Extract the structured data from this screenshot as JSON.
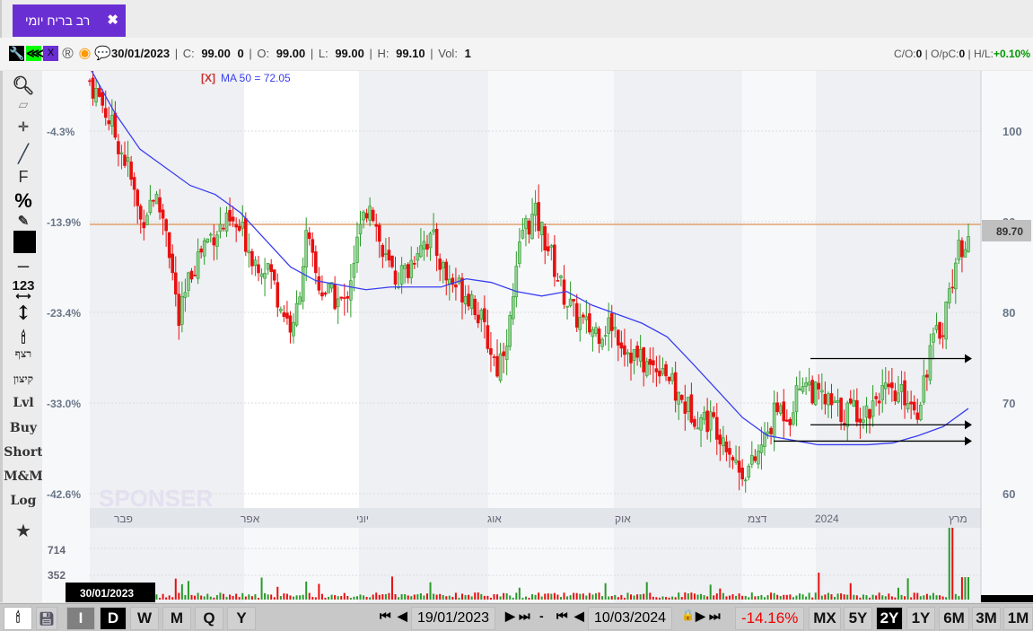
{
  "tab": {
    "title": "רב בריח יומי",
    "close": "✖"
  },
  "info": {
    "date": "30/01/2023",
    "c_label": "C:",
    "c": "99.00",
    "c_change": "0",
    "o_label": "O:",
    "o": "99.00",
    "l_label": "L:",
    "l": "99.00",
    "h_label": "H:",
    "h": "99.10",
    "vol_label": "Vol:",
    "vol": "1",
    "co_label": "C/O:",
    "co": "0",
    "opc_label": "O/pC:",
    "opc": "0",
    "hl_label": "H/L:",
    "hl": "+0.10%",
    "icons": [
      "wrench-icon",
      "share-icon",
      "excel-icon",
      "registered-icon",
      "target-icon",
      "comment-icon"
    ]
  },
  "toolbar": {
    "items": [
      "search",
      "eraser",
      "crosshair",
      "line",
      "F",
      "%",
      "edit",
      "color",
      "line-style",
      "123",
      "vertical",
      "candles",
      "רצף",
      "קיצון",
      "Lvl",
      "Buy",
      "Short",
      "M&M",
      "Log",
      "star"
    ]
  },
  "chart_data": {
    "type": "candlestick",
    "indicator": {
      "remove": "[X]",
      "label": "MA 50 = 72.05"
    },
    "price_axis": {
      "ticks": [
        60,
        70,
        80,
        90,
        100
      ],
      "ylim": [
        58,
        107
      ]
    },
    "percent_axis": [
      "-4.3%",
      "-13.9%",
      "-23.4%",
      "-33.0%",
      "-42.6%"
    ],
    "last_price": "89.70",
    "hline": 89.7,
    "months": [
      "פבר",
      "אפר",
      "יוני",
      "אוג",
      "אוק",
      "דצמ",
      "2024",
      "מרץ"
    ],
    "volume_ticks": [
      "714",
      "352"
    ],
    "closes": [
      105.5,
      103,
      99.6,
      96,
      90,
      93,
      89.7,
      78.8,
      84.7,
      87.7,
      89.2,
      89.7,
      88.7,
      85.7,
      85.2,
      80.8,
      77.8,
      88.2,
      82.8,
      81.8,
      80.8,
      87.7,
      92.7,
      86.2,
      83.8,
      84.7,
      88.2,
      87.7,
      83.8,
      82.8,
      81.8,
      77.8,
      73.9,
      78.8,
      89.2,
      90.6,
      87.2,
      82.8,
      79.8,
      78.3,
      78,
      78.8,
      76.3,
      74.9,
      73.9,
      74.4,
      70.9,
      69.4,
      68.4,
      67.9,
      65.9,
      62.5,
      63,
      65.9,
      69.4,
      68.9,
      72.9,
      70.9,
      69.9,
      68.9,
      69.4,
      68.9,
      71.4,
      70.4,
      70.9,
      69.4,
      75.8,
      78.8,
      85.7,
      89.2
    ],
    "ma50": [
      107,
      102,
      98,
      96,
      94,
      93,
      91,
      88,
      85,
      83.5,
      83,
      82.5,
      82.8,
      82.8,
      82.8,
      83.7,
      83.3,
      82.3,
      81.8,
      82.3,
      80.8,
      79.8,
      78.8,
      77.3,
      74.4,
      71.4,
      68.4,
      66.4,
      65.9,
      65.4,
      65.4,
      65.4,
      65.6,
      66.4,
      67.4,
      69.4
    ],
    "arrows": [
      74.9,
      67.6,
      65.8
    ]
  },
  "bottom": {
    "periods": [
      "I",
      "D",
      "W",
      "M",
      "Q",
      "Y"
    ],
    "active_period": "D",
    "start_date": "19/01/2023",
    "end_date": "10/03/2024",
    "dash": "-",
    "change": "-14.16%",
    "ranges": [
      "MX",
      "5Y",
      "2Y",
      "1Y",
      "6M",
      "3M",
      "1M"
    ],
    "active_range": "2Y",
    "cursor_date": "30/01/2023",
    "nav_first": "⏮",
    "nav_prev": "◀",
    "nav_next": "▶",
    "nav_last": "⏭",
    "lock": "🔒"
  }
}
